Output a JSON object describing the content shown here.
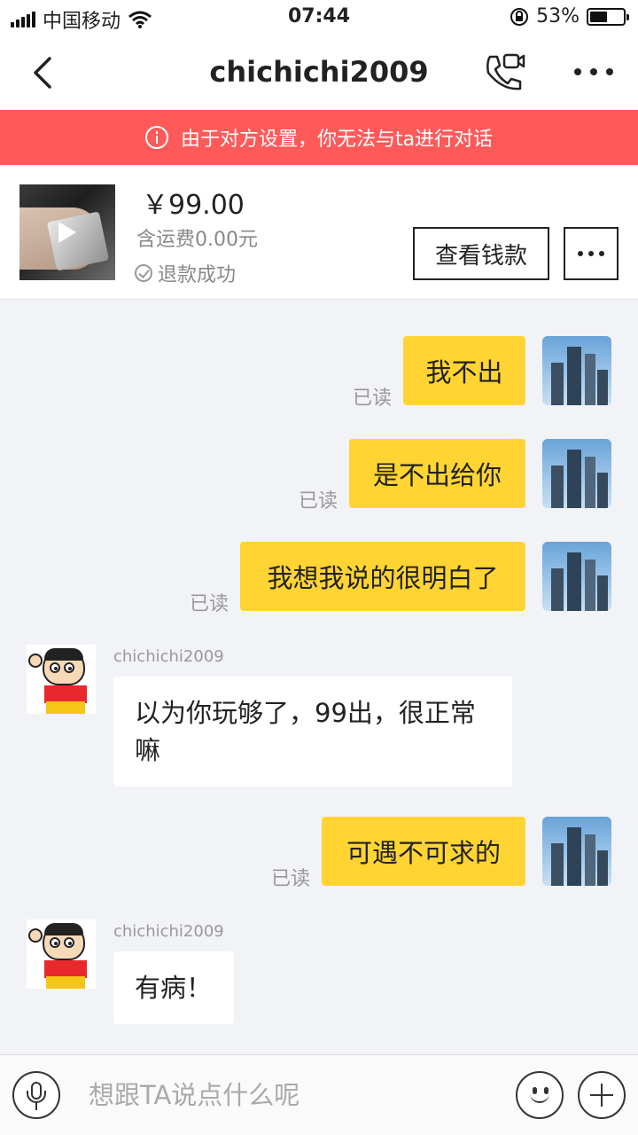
{
  "status_bar": {
    "carrier": "中国移动",
    "time": "07:44",
    "battery_text": "53%",
    "battery_level": 0.53
  },
  "header": {
    "title": "chichichi2009",
    "icons": [
      "back-arrow",
      "video-call",
      "more"
    ]
  },
  "warning": {
    "text": "由于对方设置，你无法与ta进行对话",
    "color": "#ff5a5a"
  },
  "product": {
    "price": "￥99.00",
    "shipping": "含运费0.00元",
    "status": "退款成功",
    "view_button": "查看钱款"
  },
  "messages": [
    {
      "from": "me",
      "text": "我不出",
      "read": "已读"
    },
    {
      "from": "me",
      "text": "是不出给你",
      "read": "已读"
    },
    {
      "from": "me",
      "text": "我想我说的很明白了",
      "read": "已读"
    },
    {
      "from": "them",
      "sender": "chichichi2009",
      "lines": [
        "以为你玩够了，99出，很正常",
        "嘛"
      ]
    },
    {
      "from": "me",
      "text": "可遇不可求的",
      "read": "已读"
    },
    {
      "from": "them",
      "sender": "chichichi2009",
      "lines": [
        "有病！"
      ]
    }
  ],
  "input": {
    "placeholder": "想跟TA说点什么呢"
  },
  "colors": {
    "my_bubble": "#ffd433",
    "their_bubble": "#ffffff",
    "background": "#f2f3f7"
  }
}
